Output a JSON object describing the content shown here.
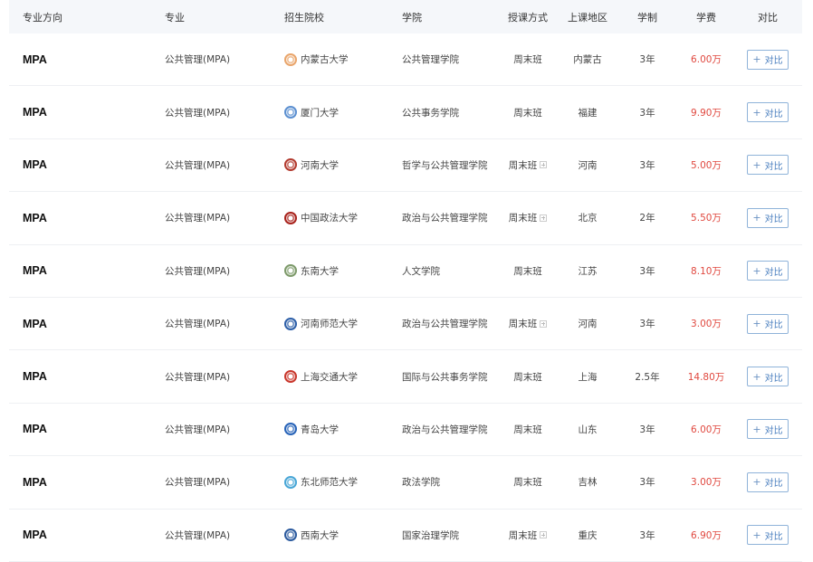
{
  "header": {
    "direction": "专业方向",
    "major": "专业",
    "school": "招生院校",
    "college": "学院",
    "mode": "授课方式",
    "region": "上课地区",
    "duration": "学制",
    "fee": "学费",
    "compare": "对比"
  },
  "compare_button_label": "对比",
  "compare_plus_icon": "+",
  "rows": [
    {
      "direction": "MPA",
      "major": "公共管理(MPA)",
      "school": "内蒙古大学",
      "logo_color": "#e9a56b",
      "college": "公共管理学院",
      "mode": "周末班",
      "mode_expand": false,
      "region": "内蒙古",
      "duration": "3年",
      "fee": "6.00万"
    },
    {
      "direction": "MPA",
      "major": "公共管理(MPA)",
      "school": "厦门大学",
      "logo_color": "#5b8fd0",
      "college": "公共事务学院",
      "mode": "周末班",
      "mode_expand": false,
      "region": "福建",
      "duration": "3年",
      "fee": "9.90万"
    },
    {
      "direction": "MPA",
      "major": "公共管理(MPA)",
      "school": "河南大学",
      "logo_color": "#b23a2e",
      "college": "哲学与公共管理学院",
      "mode": "周末班",
      "mode_expand": true,
      "region": "河南",
      "duration": "3年",
      "fee": "5.00万"
    },
    {
      "direction": "MPA",
      "major": "公共管理(MPA)",
      "school": "中国政法大学",
      "logo_color": "#a8221c",
      "college": "政治与公共管理学院",
      "mode": "周末班",
      "mode_expand": true,
      "region": "北京",
      "duration": "2年",
      "fee": "5.50万"
    },
    {
      "direction": "MPA",
      "major": "公共管理(MPA)",
      "school": "东南大学",
      "logo_color": "#7d9a6a",
      "college": "人文学院",
      "mode": "周末班",
      "mode_expand": false,
      "region": "江苏",
      "duration": "3年",
      "fee": "8.10万"
    },
    {
      "direction": "MPA",
      "major": "公共管理(MPA)",
      "school": "河南师范大学",
      "logo_color": "#2d5fa8",
      "college": "政治与公共管理学院",
      "mode": "周末班",
      "mode_expand": true,
      "region": "河南",
      "duration": "3年",
      "fee": "3.00万"
    },
    {
      "direction": "MPA",
      "major": "公共管理(MPA)",
      "school": "上海交通大学",
      "logo_color": "#c9372c",
      "college": "国际与公共事务学院",
      "mode": "周末班",
      "mode_expand": false,
      "region": "上海",
      "duration": "2.5年",
      "fee": "14.80万"
    },
    {
      "direction": "MPA",
      "major": "公共管理(MPA)",
      "school": "青岛大学",
      "logo_color": "#2763b8",
      "college": "政治与公共管理学院",
      "mode": "周末班",
      "mode_expand": false,
      "region": "山东",
      "duration": "3年",
      "fee": "6.00万"
    },
    {
      "direction": "MPA",
      "major": "公共管理(MPA)",
      "school": "东北师范大学",
      "logo_color": "#48a6d6",
      "college": "政法学院",
      "mode": "周末班",
      "mode_expand": false,
      "region": "吉林",
      "duration": "3年",
      "fee": "3.00万"
    },
    {
      "direction": "MPA",
      "major": "公共管理(MPA)",
      "school": "西南大学",
      "logo_color": "#2b5a9e",
      "college": "国家治理学院",
      "mode": "周末班",
      "mode_expand": true,
      "region": "重庆",
      "duration": "3年",
      "fee": "6.90万"
    }
  ]
}
